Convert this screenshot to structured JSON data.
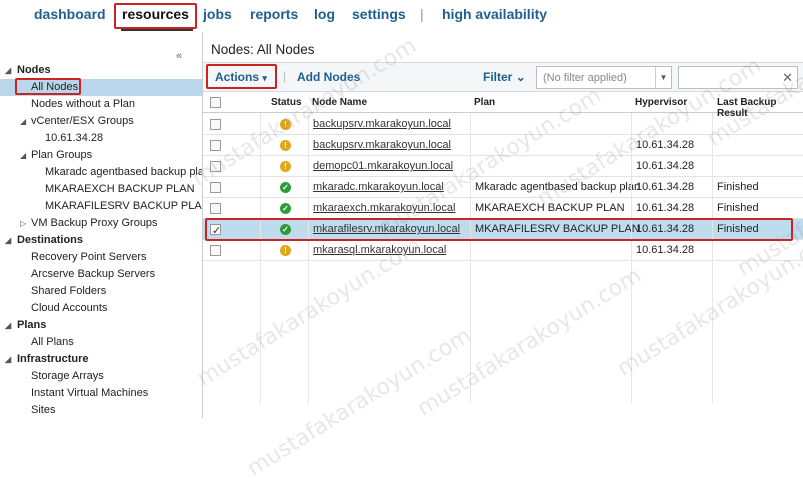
{
  "topnav": {
    "items": [
      "dashboard",
      "resources",
      "jobs",
      "reports",
      "log",
      "settings",
      "high availability"
    ],
    "separator": "|"
  },
  "sidebar": {
    "collapse_glyph": "«",
    "groups": [
      {
        "label": "Nodes",
        "items": [
          "All Nodes",
          "Nodes without a Plan",
          "vCenter/ESX Groups",
          "10.61.34.28",
          "Plan Groups",
          "Mkaradc agentbased backup plan",
          "MKARAEXCH BACKUP PLAN",
          "MKARAFILESRV BACKUP PLAN",
          "VM Backup Proxy Groups"
        ]
      },
      {
        "label": "Destinations",
        "items": [
          "Recovery Point Servers",
          "Arcserve Backup Servers",
          "Shared Folders",
          "Cloud Accounts"
        ]
      },
      {
        "label": "Plans",
        "items": [
          "All Plans"
        ]
      },
      {
        "label": "Infrastructure",
        "items": [
          "Storage Arrays",
          "Instant Virtual Machines",
          "Sites"
        ]
      }
    ]
  },
  "main": {
    "title": "Nodes: All Nodes",
    "toolbar": {
      "actions_label": "Actions",
      "actions_caret": "▾",
      "add_nodes_label": "Add Nodes",
      "filter_label": "Filter",
      "filter_caret": "⌄",
      "filter_placeholder": "(No filter applied)",
      "clear_glyph": "✕"
    },
    "grid": {
      "columns": [
        "Status",
        "Node Name",
        "Plan",
        "Hypervisor",
        "Last Backup Result"
      ],
      "rows": [
        {
          "status": "warning",
          "node": "backupsrv.mkarakoyun.local",
          "plan": "",
          "hypervisor": "",
          "result": "",
          "checked": false
        },
        {
          "status": "warning",
          "node": "backupsrv.mkarakoyun.local",
          "plan": "",
          "hypervisor": "10.61.34.28",
          "result": "",
          "checked": false
        },
        {
          "status": "warning",
          "node": "demopc01.mkarakoyun.local",
          "plan": "",
          "hypervisor": "10.61.34.28",
          "result": "",
          "checked": false
        },
        {
          "status": "ok",
          "node": "mkaradc.mkarakoyun.local",
          "plan": "Mkaradc agentbased backup plan",
          "hypervisor": "10.61.34.28",
          "result": "Finished",
          "checked": false
        },
        {
          "status": "ok",
          "node": "mkaraexch.mkarakoyun.local",
          "plan": "MKARAEXCH BACKUP PLAN",
          "hypervisor": "10.61.34.28",
          "result": "Finished",
          "checked": false
        },
        {
          "status": "ok",
          "node": "mkarafilesrv.mkarakoyun.local",
          "plan": "MKARAFILESRV BACKUP PLAN",
          "hypervisor": "10.61.34.28",
          "result": "Finished",
          "checked": true
        },
        {
          "status": "warning",
          "node": "mkarasql.mkarakoyun.local",
          "plan": "",
          "hypervisor": "10.61.34.28",
          "result": "",
          "checked": false
        }
      ]
    }
  },
  "watermark": "mustafakarakoyun.com",
  "colors": {
    "accent": "#1e5f8f",
    "highlight": "#cc2222",
    "selected_row": "#bfdcef",
    "ok": "#2e9a3c",
    "warning": "#e3a51a"
  }
}
